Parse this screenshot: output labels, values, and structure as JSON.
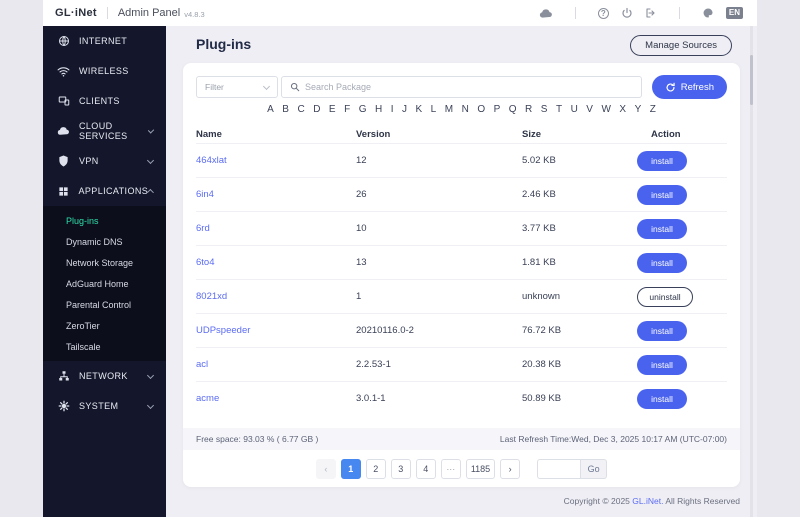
{
  "colors": {
    "accent": "#4a63ee",
    "teal_active": "#2de0a8",
    "link": "#5b6cf3",
    "pagination_active": "#4687f0",
    "sidebar_bg": "#14172b"
  },
  "header": {
    "logo": "GL·iNet",
    "app_title": "Admin Panel",
    "version": "v4.8.3",
    "help_glyph": "?",
    "language": "EN"
  },
  "sidebar": {
    "top_items": [
      {
        "label": "INTERNET"
      },
      {
        "label": "WIRELESS"
      },
      {
        "label": "CLIENTS"
      },
      {
        "label": "CLOUD SERVICES"
      },
      {
        "label": "VPN"
      },
      {
        "label": "APPLICATIONS"
      }
    ],
    "submenu": [
      "Plug-ins",
      "Dynamic DNS",
      "Network Storage",
      "AdGuard Home",
      "Parental Control",
      "ZeroTier",
      "Tailscale"
    ],
    "active_item": "Plug-ins",
    "bottom_items": [
      {
        "label": "NETWORK"
      },
      {
        "label": "SYSTEM"
      }
    ]
  },
  "page": {
    "title": "Plug-ins",
    "manage_sources_label": "Manage Sources",
    "filter_placeholder": "Filter",
    "search_placeholder": "Search Package",
    "refresh_label": "Refresh",
    "letters": [
      "A",
      "B",
      "C",
      "D",
      "E",
      "F",
      "G",
      "H",
      "I",
      "J",
      "K",
      "L",
      "M",
      "N",
      "O",
      "P",
      "Q",
      "R",
      "S",
      "T",
      "U",
      "V",
      "W",
      "X",
      "Y",
      "Z"
    ]
  },
  "table": {
    "columns": [
      "Name",
      "Version",
      "Size",
      "Action"
    ],
    "rows": [
      {
        "name": "464xlat",
        "version": "12",
        "size": "5.02 KB",
        "action": "install"
      },
      {
        "name": "6in4",
        "version": "26",
        "size": "2.46 KB",
        "action": "install"
      },
      {
        "name": "6rd",
        "version": "10",
        "size": "3.77 KB",
        "action": "install"
      },
      {
        "name": "6to4",
        "version": "13",
        "size": "1.81 KB",
        "action": "install"
      },
      {
        "name": "8021xd",
        "version": "1",
        "size": "unknown",
        "action": "uninstall"
      },
      {
        "name": "UDPspeeder",
        "version": "20210116.0-2",
        "size": "76.72 KB",
        "action": "install"
      },
      {
        "name": "acl",
        "version": "2.2.53-1",
        "size": "20.38 KB",
        "action": "install"
      },
      {
        "name": "acme",
        "version": "3.0.1-1",
        "size": "50.89 KB",
        "action": "install"
      }
    ]
  },
  "status_bar": {
    "free_space": "Free space: 93.03 % ( 6.77 GB )",
    "last_refresh": "Last Refresh Time:Wed, Dec 3, 2025 10:17 AM (UTC-07:00)"
  },
  "pagination": {
    "prev": "‹",
    "pages": [
      "1",
      "2",
      "3",
      "4",
      "···",
      "1185"
    ],
    "active_page": "1",
    "next": "›",
    "go_label": "Go"
  },
  "footer": {
    "copyright_prefix": "Copyright © 2025 ",
    "copyright_link": "GL.iNet.",
    "copyright_suffix": " All Rights Reserved"
  }
}
